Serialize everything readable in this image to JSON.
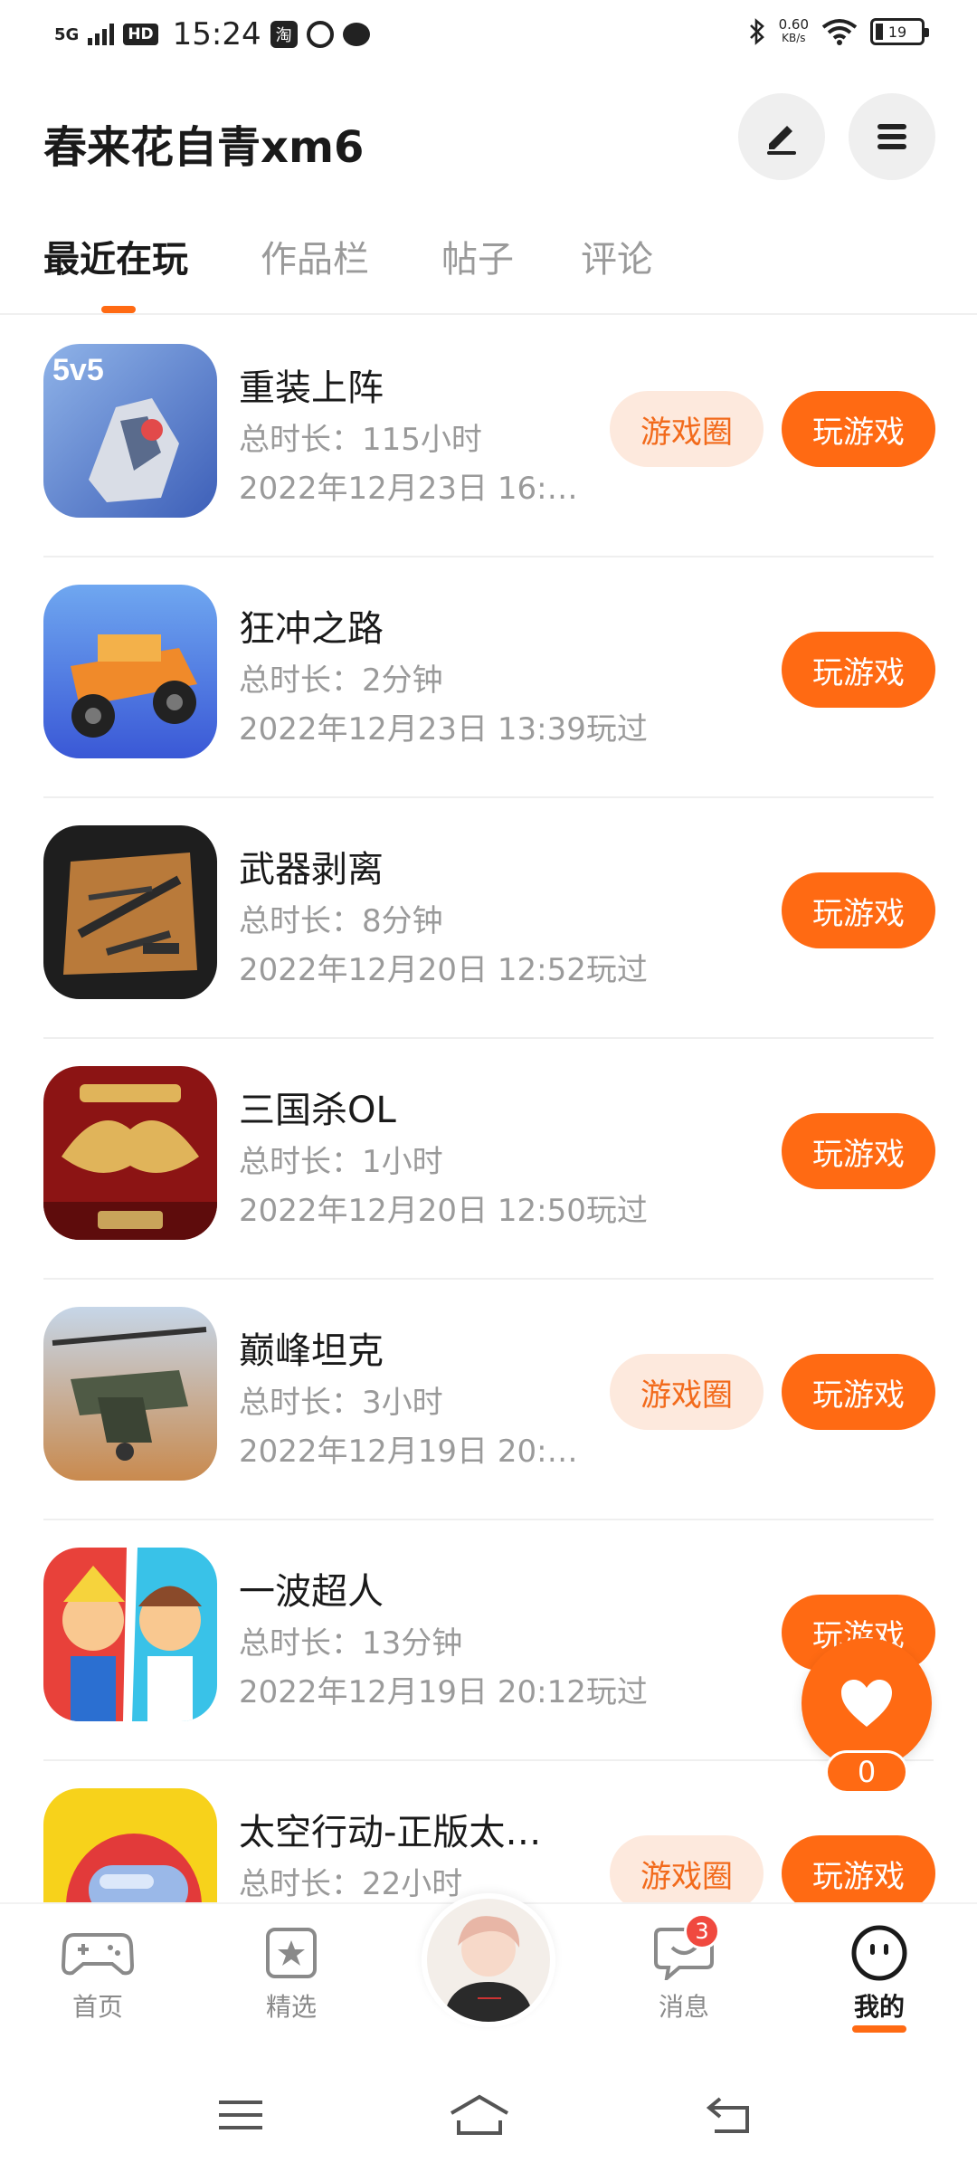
{
  "status_bar": {
    "signal": "5G",
    "hd": "HD",
    "time": "15:24",
    "app_icon_text": "淘",
    "net_speed_value": "0.60",
    "net_speed_unit": "KB/s",
    "battery": "19"
  },
  "header": {
    "username": "春来花自青xm6",
    "icons": [
      "edit-icon",
      "menu-icon"
    ]
  },
  "tabs": [
    {
      "label": "最近在玩",
      "active": true
    },
    {
      "label": "作品栏",
      "active": false
    },
    {
      "label": "帖子",
      "active": false
    },
    {
      "label": "评论",
      "active": false
    }
  ],
  "games": [
    {
      "name": "重装上阵",
      "playtime": "总时长：115小时",
      "last_played": "2022年12月23日 16:…",
      "has_circle": true,
      "icon_colors": [
        "#3d5fb8",
        "#8fb3e8"
      ]
    },
    {
      "name": "狂冲之路",
      "playtime": "总时长：2分钟",
      "last_played": "2022年12月23日 13:39玩过",
      "has_circle": false,
      "icon_colors": [
        "#3a58d6",
        "#f08a2a"
      ]
    },
    {
      "name": "武器剥离",
      "playtime": "总时长：8分钟",
      "last_played": "2022年12月20日 12:52玩过",
      "has_circle": false,
      "icon_colors": [
        "#1e1e1e",
        "#b97a3a"
      ]
    },
    {
      "name": "三国杀OL",
      "playtime": "总时长：1小时",
      "last_played": "2022年12月20日 12:50玩过",
      "has_circle": false,
      "icon_colors": [
        "#8c1414",
        "#e0b45a"
      ]
    },
    {
      "name": "巅峰坦克",
      "playtime": "总时长：3小时",
      "last_played": "2022年12月19日 20:…",
      "has_circle": true,
      "icon_colors": [
        "#7fa4c8",
        "#c98a4e"
      ]
    },
    {
      "name": "一波超人",
      "playtime": "总时长：13分钟",
      "last_played": "2022年12月19日 20:12玩过",
      "has_circle": false,
      "icon_colors": [
        "#e8413a",
        "#39c2e8"
      ]
    },
    {
      "name": "太空行动-正版太…",
      "playtime": "总时长：22小时",
      "last_played": "",
      "has_circle": true,
      "icon_colors": [
        "#f7d21b",
        "#e23a3a"
      ]
    }
  ],
  "buttons": {
    "circle_label": "游戏圈",
    "play_label": "玩游戏"
  },
  "like": {
    "count": "0"
  },
  "bottom_nav": [
    {
      "label": "首页",
      "icon": "gamepad-icon",
      "active": false
    },
    {
      "label": "精选",
      "icon": "star-bookmark-icon",
      "active": false
    },
    {
      "label": "",
      "icon": "avatar",
      "active": false
    },
    {
      "label": "消息",
      "icon": "message-icon",
      "active": false,
      "badge": "3"
    },
    {
      "label": "我的",
      "icon": "face-icon",
      "active": true
    }
  ],
  "colors": {
    "accent": "#ff6a13",
    "circle_bg": "#fde9dd",
    "badge": "#f0493f"
  }
}
